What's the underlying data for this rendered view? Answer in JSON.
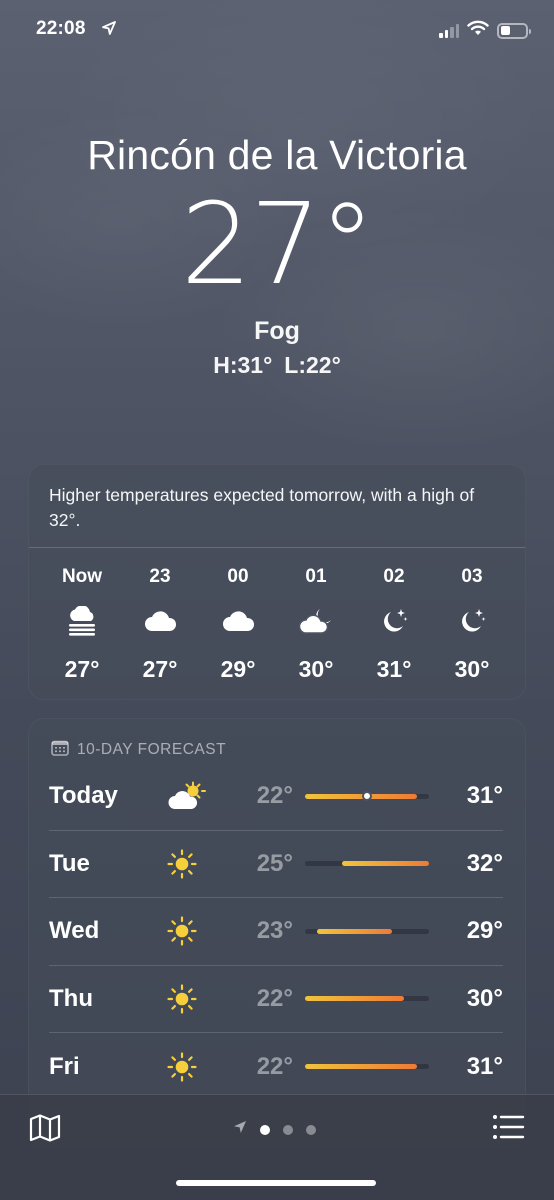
{
  "status_bar": {
    "time": "22:08",
    "location_icon": "location-arrow-icon",
    "signal_icon": "cellular-signal-icon",
    "wifi_icon": "wifi-icon",
    "battery_icon": "battery-icon",
    "battery_level": 0.4
  },
  "current": {
    "city": "Rincón de la Victoria",
    "temperature": "27°",
    "condition": "Fog",
    "high": "H:31°",
    "low": "L:22°"
  },
  "hourly": {
    "summary": "Higher temperatures expected tomorrow, with a high of 32°.",
    "hours": [
      {
        "label": "Now",
        "icon": "fog-icon",
        "temp": "27°"
      },
      {
        "label": "23",
        "icon": "cloud-icon",
        "temp": "27°"
      },
      {
        "label": "00",
        "icon": "cloud-icon",
        "temp": "29°"
      },
      {
        "label": "01",
        "icon": "cloud-moon-icon",
        "temp": "30°"
      },
      {
        "label": "02",
        "icon": "moon-stars-icon",
        "temp": "31°"
      },
      {
        "label": "03",
        "icon": "moon-stars-icon",
        "temp": "30°"
      }
    ]
  },
  "forecast": {
    "header_icon": "calendar-icon",
    "title": "10-DAY FORECAST",
    "range_min": 22,
    "range_max": 32,
    "days": [
      {
        "day": "Today",
        "icon": "partly-sunny-icon",
        "low": "22°",
        "high": "31°",
        "low_value": 22,
        "high_value": 31,
        "current_value": 27
      },
      {
        "day": "Tue",
        "icon": "sun-icon",
        "low": "25°",
        "high": "32°",
        "low_value": 25,
        "high_value": 32
      },
      {
        "day": "Wed",
        "icon": "sun-icon",
        "low": "23°",
        "high": "29°",
        "low_value": 23,
        "high_value": 29
      },
      {
        "day": "Thu",
        "icon": "sun-icon",
        "low": "22°",
        "high": "30°",
        "low_value": 22,
        "high_value": 30
      },
      {
        "day": "Fri",
        "icon": "sun-icon",
        "low": "22°",
        "high": "31°",
        "low_value": 22,
        "high_value": 31
      }
    ]
  },
  "bottom_bar": {
    "map_icon": "map-icon",
    "list_icon": "list-icon",
    "pages": [
      "location-arrow-icon",
      "dot",
      "dot",
      "dot"
    ],
    "active_page": 1
  },
  "colors": {
    "bar_cool": "#f0c43c",
    "bar_warm": "#ef7a35",
    "sun": "#f7cf3a"
  }
}
